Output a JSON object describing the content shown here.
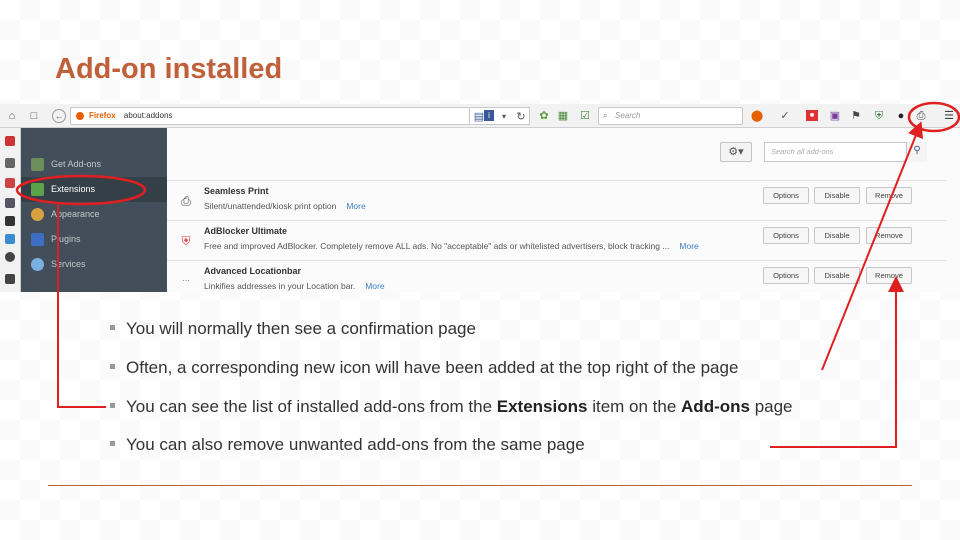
{
  "slide": {
    "title": "Add-on installed"
  },
  "browser": {
    "url_brand": "Firefox",
    "url": "about:addons",
    "search_placeholder": "Search"
  },
  "sidebar": {
    "items": [
      {
        "label": "Get Add-ons",
        "icon": "get-addons-icon"
      },
      {
        "label": "Extensions",
        "icon": "puzzle-icon"
      },
      {
        "label": "Appearance",
        "icon": "palette-icon"
      },
      {
        "label": "Plugins",
        "icon": "plugin-icon"
      },
      {
        "label": "Services",
        "icon": "services-icon"
      }
    ],
    "active_index": 1
  },
  "addons_page": {
    "search_placeholder": "Search all add-ons",
    "addons": [
      {
        "name": "Seamless Print",
        "description": "Silent/unattended/kiosk print option",
        "more": "More",
        "buttons": [
          "Options",
          "Disable",
          "Remove"
        ]
      },
      {
        "name": "AdBlocker Ultimate",
        "description": "Free and improved AdBlocker. Completely remove ALL ads. No \"acceptable\" ads or whitelisted advertisers, block tracking ...",
        "more": "More",
        "buttons": [
          "Options",
          "Disable",
          "Remove"
        ]
      },
      {
        "name": "Advanced Locationbar",
        "description": "Linkifies addresses in your Location bar.",
        "more": "More",
        "buttons": [
          "Options",
          "Disable",
          "Remove"
        ]
      }
    ]
  },
  "bullets": [
    {
      "parts": [
        {
          "t": "You will normally then see a confirmation page",
          "b": false
        }
      ]
    },
    {
      "parts": [
        {
          "t": "Often, a corresponding new icon will have been added at the top right of the page",
          "b": false
        }
      ]
    },
    {
      "parts": [
        {
          "t": "You can see the list of installed add-ons from the ",
          "b": false
        },
        {
          "t": "Extensions",
          "b": true
        },
        {
          "t": " item on the ",
          "b": false
        },
        {
          "t": "Add-ons",
          "b": true
        },
        {
          "t": " page",
          "b": false
        }
      ]
    },
    {
      "parts": [
        {
          "t": "You can also remove unwanted add-ons from the same page",
          "b": false
        }
      ]
    }
  ],
  "colors": {
    "title": "#c0603a",
    "annotation": "#e02020",
    "sidebar_bg": "#424f5a"
  }
}
